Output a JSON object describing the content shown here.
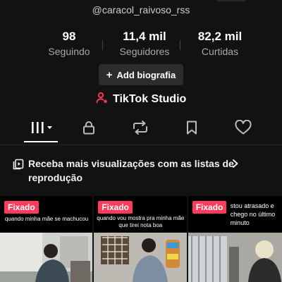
{
  "profile": {
    "handle": "@caracol_raivoso_rss"
  },
  "stats": [
    {
      "value": "98",
      "label": "Seguindo"
    },
    {
      "value": "11,4 mil",
      "label": "Seguidores"
    },
    {
      "value": "82,2 mil",
      "label": "Curtidas"
    }
  ],
  "actions": {
    "bio_label": "Add biografia",
    "studio_label": "TikTok Studio"
  },
  "tabs": [
    {
      "icon": "grid-icon",
      "selected": true
    },
    {
      "icon": "lock-icon",
      "selected": false
    },
    {
      "icon": "repost-icon",
      "selected": false
    },
    {
      "icon": "bookmark-icon",
      "selected": false
    },
    {
      "icon": "heart-icon",
      "selected": false
    }
  ],
  "playlist_banner": {
    "text": "Receba mais visualizações com as listas de reprodução"
  },
  "videos": [
    {
      "badge": "Fixado",
      "caption": "quando minha mãe se machucou"
    },
    {
      "badge": "Fixado",
      "caption": "quando vou mostra pra minha mãe que tirei nota boa"
    },
    {
      "badge": "Fixado",
      "caption": "stou atrasado e chego no último minuto"
    }
  ],
  "colors": {
    "background": "#121212",
    "accent": "#ff3b5c",
    "muted_text": "#a8a8a8"
  }
}
